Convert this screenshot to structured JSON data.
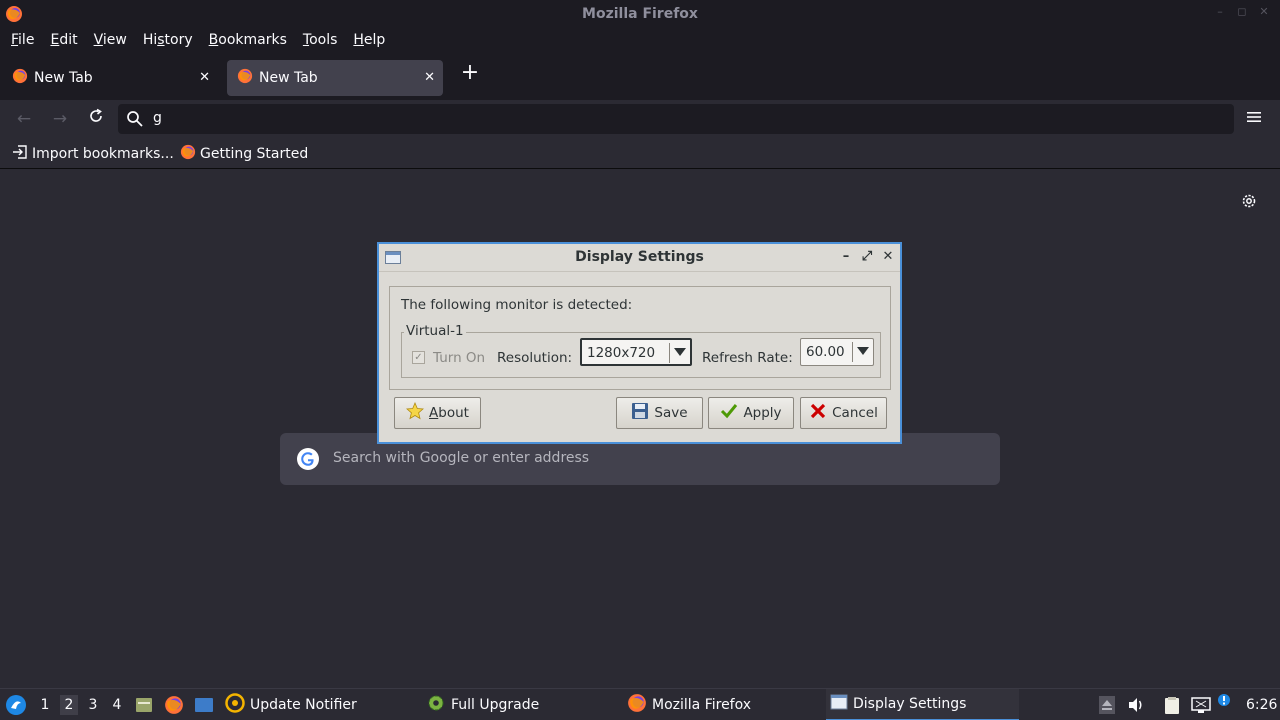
{
  "window": {
    "title": "Mozilla Firefox"
  },
  "menubar": {
    "items": [
      {
        "pre": "",
        "u": "F",
        "post": "ile"
      },
      {
        "pre": "",
        "u": "E",
        "post": "dit"
      },
      {
        "pre": "",
        "u": "V",
        "post": "iew"
      },
      {
        "pre": "Hi",
        "u": "s",
        "post": "tory"
      },
      {
        "pre": "",
        "u": "B",
        "post": "ookmarks"
      },
      {
        "pre": "",
        "u": "T",
        "post": "ools"
      },
      {
        "pre": "",
        "u": "H",
        "post": "elp"
      }
    ]
  },
  "tabs": [
    {
      "title": "New Tab",
      "active": false
    },
    {
      "title": "New Tab",
      "active": true
    }
  ],
  "navbar": {
    "url_text": "g"
  },
  "bookmarks": [
    {
      "label": "Import bookmarks...",
      "icon": "import-icon"
    },
    {
      "label": "Getting Started",
      "icon": "firefox-icon"
    }
  ],
  "newtab": {
    "search_placeholder": "Search with Google or enter address"
  },
  "dialog": {
    "title": "Display Settings",
    "message": "The following monitor is detected:",
    "monitor_name": "Virtual-1",
    "turn_on_label": "Turn On",
    "turn_on_checked": true,
    "resolution_label": "Resolution:",
    "resolution_value": "1280x720",
    "refresh_label": "Refresh Rate:",
    "refresh_value": "60.00",
    "buttons": {
      "about": {
        "pre": "",
        "u": "A",
        "post": "bout"
      },
      "save": "Save",
      "apply": "Apply",
      "cancel": "Cancel"
    }
  },
  "taskbar": {
    "workspaces": [
      "1",
      "2",
      "3",
      "4"
    ],
    "active_workspace": "2",
    "tasks": [
      {
        "label": "Update Notifier",
        "icon": "update-notifier-icon"
      },
      {
        "label": "Full Upgrade",
        "icon": "gear-icon"
      },
      {
        "label": "Mozilla Firefox",
        "icon": "firefox-icon"
      },
      {
        "label": "Display Settings",
        "icon": "window-icon",
        "active": true
      }
    ],
    "clock": "6:26"
  },
  "colors": {
    "accent": "#4a90d9",
    "toolbar": "#2b2a33",
    "titlebar": "#1c1b22",
    "dialog_bg": "#dcdad5"
  }
}
